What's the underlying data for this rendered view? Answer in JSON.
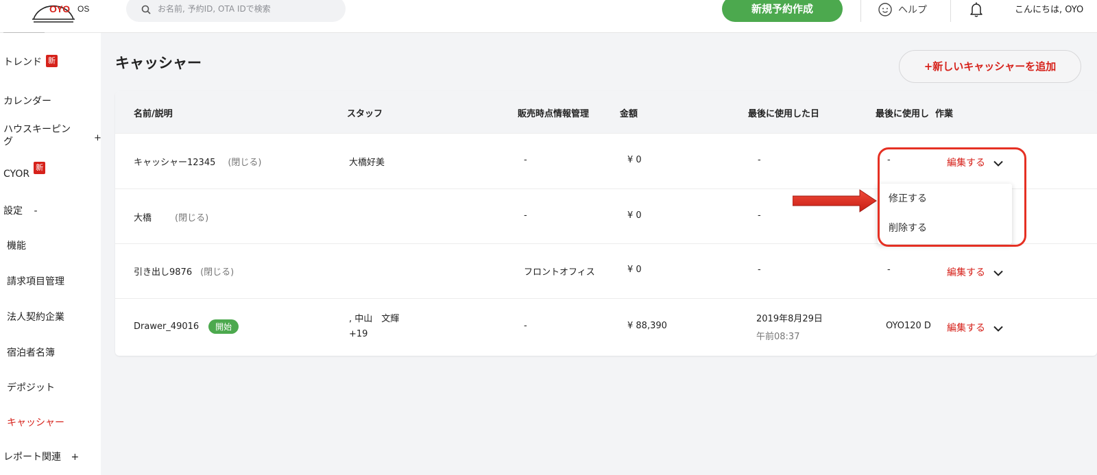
{
  "header": {
    "logo_brand": "OYO",
    "logo_os": "OS",
    "search_placeholder": "お名前, 予約ID, OTA IDで検索",
    "new_booking_label": "新規予約作成",
    "help_label": "ヘルプ",
    "greeting": "こんにちは, OYO"
  },
  "sidebar": {
    "items": [
      {
        "label": "トレンド",
        "badge": "新"
      },
      {
        "label": "カレンダー"
      },
      {
        "label": "ハウスキーピン",
        "label2": "グ",
        "expander": "+"
      },
      {
        "label": "CYOR",
        "badge": "新"
      },
      {
        "label": "設定",
        "expander": "-"
      },
      {
        "label": "機能"
      },
      {
        "label": "請求項目管理"
      },
      {
        "label": "法人契約企業"
      },
      {
        "label": "宿泊者名簿"
      },
      {
        "label": "デポジット"
      },
      {
        "label": "キャッシャー",
        "active": true
      },
      {
        "label": "レポート関連",
        "expander": "+"
      }
    ]
  },
  "main": {
    "title": "キャッシャー",
    "add_button": "+新しいキャッシャーを追加",
    "columns": [
      "名前/説明",
      "スタッフ",
      "販売時点情報管理",
      "金額",
      "最後に使用した日",
      "最後に使用し",
      "作業"
    ],
    "rows": [
      {
        "name": "キャッシャー12345",
        "status": "(閉じる)",
        "staff": "大橋好美",
        "staff2": "",
        "pos": "-",
        "amount": "¥ 0",
        "last_date": "-",
        "last_date2": "",
        "last_user": "-",
        "action": "編集する"
      },
      {
        "name": "大橋",
        "status": "(閉じる)",
        "staff": "",
        "staff2": "",
        "pos": "-",
        "amount": "¥ 0",
        "last_date": "-",
        "last_date2": "",
        "last_user": "",
        "action": ""
      },
      {
        "name": "引き出し9876",
        "status": "(閉じる)",
        "staff": "",
        "staff2": "",
        "pos": "フロントオフィス",
        "amount": "¥ 0",
        "last_date": "-",
        "last_date2": "",
        "last_user": "-",
        "action": "編集する"
      },
      {
        "name": "Drawer_49016",
        "status_badge": "開始",
        "staff": ", 中山　文輝",
        "staff2": "+19",
        "pos": "-",
        "amount": "¥ 88,390",
        "last_date": "2019年8月29日",
        "last_date2": "午前08:37",
        "last_user": "OYO120 D",
        "action": "編集する"
      }
    ],
    "dropdown": {
      "items": [
        "修正する",
        "削除する"
      ]
    }
  },
  "colors": {
    "brand_red": "#d6221b",
    "green": "#4ca94e",
    "highlight_red": "#e53023"
  }
}
